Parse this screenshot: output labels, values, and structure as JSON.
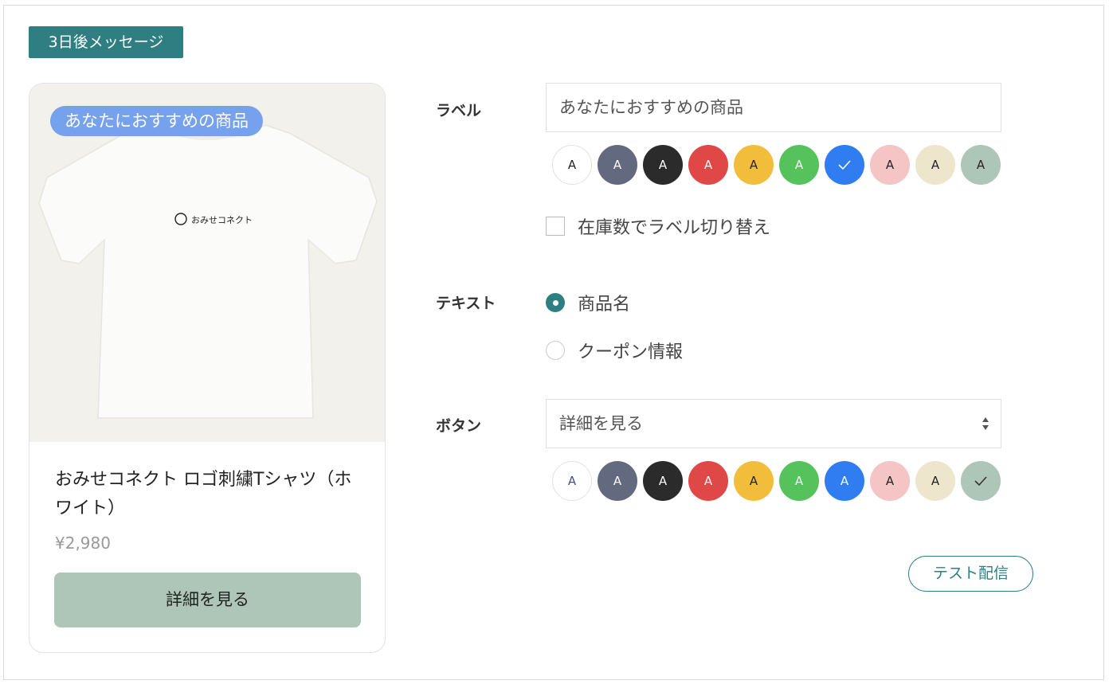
{
  "header": {
    "tag": "3日後メッセージ"
  },
  "preview": {
    "label": "あなたにおすすめの商品",
    "label_color": "#76a1ec",
    "product_title": "おみせコネクト ロゴ刺繍Tシャツ（ホワイト）",
    "price": "¥2,980",
    "button": "詳細を見る",
    "button_color": "#aec6b8",
    "logo_text": "おみせコネクト"
  },
  "form": {
    "label_field": {
      "title": "ラベル",
      "value": "あなたにおすすめの商品",
      "swatch_glyph": "A",
      "swatches": [
        "#ffffff",
        "#636a80",
        "#2b2b2b",
        "#e04848",
        "#f2bd3a",
        "#55c25b",
        "#2f7df0",
        "#f5c4c4",
        "#ede6cc",
        "#aec6b8"
      ],
      "selected_swatch_index": 6,
      "stock_toggle_label": "在庫数でラベル切り替え",
      "stock_toggle_checked": false
    },
    "text_field": {
      "title": "テキスト",
      "options": [
        "商品名",
        "クーポン情報"
      ],
      "selected": "商品名"
    },
    "button_field": {
      "title": "ボタン",
      "value": "詳細を見る",
      "swatch_glyph": "A",
      "swatches": [
        "#ffffff",
        "#636a80",
        "#2b2b2b",
        "#e04848",
        "#f2bd3a",
        "#55c25b",
        "#2f7df0",
        "#f5c4c4",
        "#ede6cc",
        "#aec6b8"
      ],
      "selected_swatch_index": 9
    },
    "test_send": "テスト配信"
  },
  "colors": {
    "accent": "#2f7f82"
  }
}
